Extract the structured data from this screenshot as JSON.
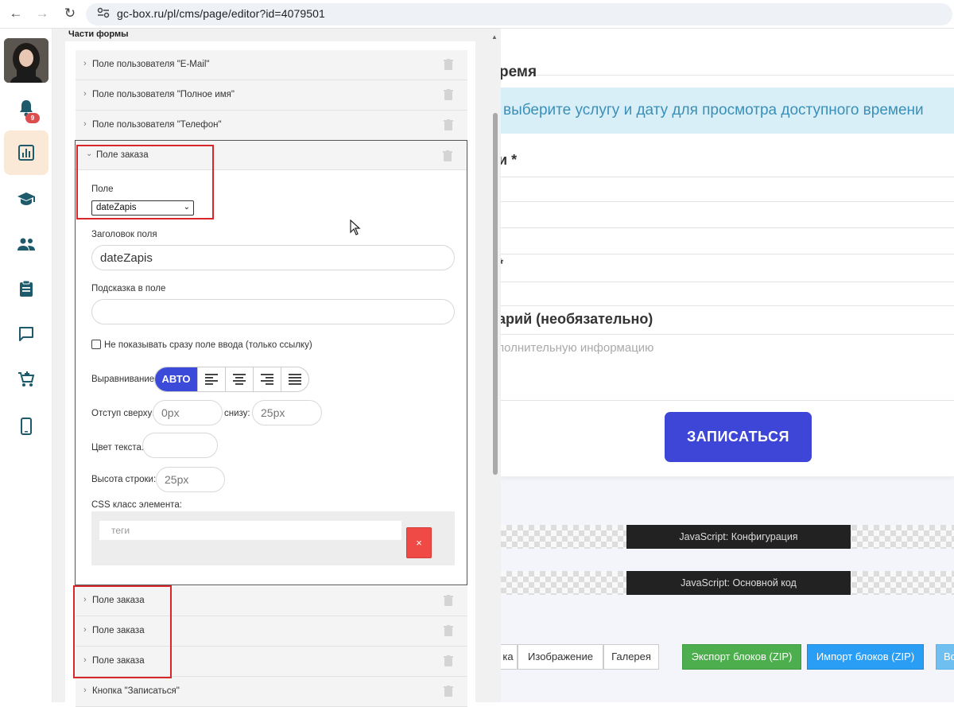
{
  "browser": {
    "url": "gc-box.ru/pl/cms/page/editor?id=4079501",
    "back_glyph": "←",
    "forward_glyph": "→",
    "reload_glyph": "↻"
  },
  "sidebar": {
    "notification_count": "9",
    "items": [
      {
        "icon": "bell-icon"
      },
      {
        "icon": "chart-icon",
        "active": true
      },
      {
        "icon": "graduation-cap-icon"
      },
      {
        "icon": "users-icon"
      },
      {
        "icon": "clipboard-icon"
      },
      {
        "icon": "chat-icon"
      },
      {
        "icon": "cart-add-icon"
      },
      {
        "icon": "mobile-icon"
      }
    ]
  },
  "editor": {
    "section_title": "Части формы",
    "rows_top": [
      "Поле пользователя \"E-Mail\"",
      "Поле пользователя \"Полное имя\"",
      "Поле пользователя \"Телефон\""
    ],
    "expanded": {
      "title": "Поле заказа",
      "field_label": "Поле",
      "field_value": "dateZapis",
      "header_label": "Заголовок поля",
      "header_value": "dateZapis",
      "hint_label": "Подсказка в поле",
      "hint_value": "",
      "no_show_label": "Не показывать сразу поле ввода (только ссылку)",
      "align_label": "Выравнивание",
      "align_auto": "АВТО",
      "margin_top_label": "Отступ сверху:",
      "margin_top_placeholder": "0px",
      "margin_bottom_label": "снизу:",
      "margin_bottom_placeholder": "25px",
      "text_color_label": "Цвет текста:",
      "line_height_label": "Высота строки:",
      "line_height_placeholder": "25px",
      "css_class_label": "CSS класс элемента:",
      "tags_placeholder": "теги",
      "delete_glyph": "×"
    },
    "rows_bottom": [
      "Поле заказа",
      "Поле заказа",
      "Поле заказа",
      "Кнопка \"Записаться\""
    ]
  },
  "preview": {
    "heading_fragment": "ремя",
    "info_text": "выберите услугу и дату для просмотра доступного времени",
    "label_fragment_1": "и *",
    "label_fragment_2": "*",
    "comment_label_fragment": "арий (необязательно)",
    "comment_placeholder_fragment": "полнительную информацию",
    "submit_label": "ЗАПИСАТЬСЯ",
    "js_config_label": "JavaScript: Конфигурация",
    "js_main_label": "JavaScript: Основной код",
    "toolbar": {
      "btn_partial": "ка",
      "btn_image": "Изображение",
      "btn_gallery": "Галерея",
      "btn_export": "Экспорт блоков (ZIP)",
      "btn_import": "Импорт блоков (ZIP)",
      "btn_more_partial": "Во"
    }
  },
  "colors": {
    "accent": "#3b4ad9",
    "highlight_box": "#d9262b",
    "active_sidebar": "#fbe9d7",
    "info_bg": "#d9eff7",
    "export_green": "#4cae4c",
    "import_blue": "#2a9df4"
  }
}
